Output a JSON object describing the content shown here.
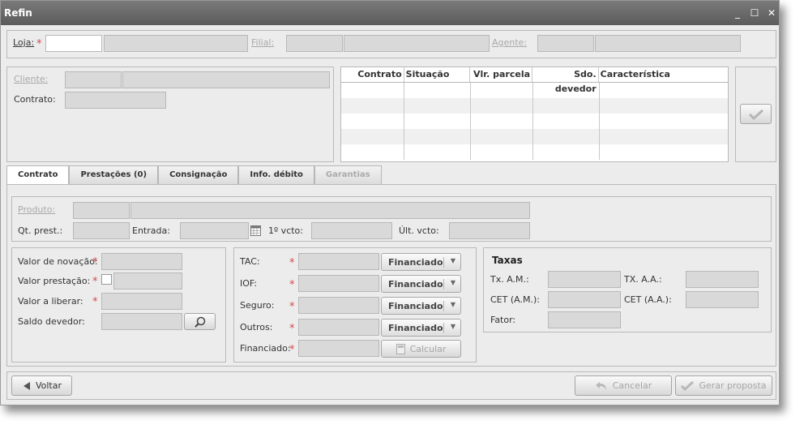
{
  "window": {
    "title": "Refin",
    "min": "_",
    "max": "☐",
    "close": "✕"
  },
  "header": {
    "loja": "Loja:",
    "filial": "Filial:",
    "agente": "Agente:"
  },
  "cliente": {
    "cliente_label": "Cliente:",
    "contrato_label": "Contrato:"
  },
  "table": {
    "columns": [
      "Contrato",
      "Situação",
      "Vlr. parcela",
      "Sdo. devedor",
      "Característica"
    ]
  },
  "tabs": [
    "Contrato",
    "Prestações (0)",
    "Consignação",
    "Info. débito",
    "Garantias"
  ],
  "produto": {
    "produto_label": "Produto:",
    "qt_prest": "Qt. prest.:",
    "entrada": "Entrada:",
    "primeiro_vcto": "1º vcto:",
    "ult_vcto": "Últ. vcto:"
  },
  "valores": {
    "novacao": "Valor de novação:",
    "prestacao": "Valor prestação:",
    "liberar": "Valor a liberar:",
    "saldo": "Saldo devedor:"
  },
  "custos": {
    "tac": "TAC:",
    "iof": "IOF:",
    "seguro": "Seguro:",
    "outros": "Outros:",
    "financiado": "Financiado:",
    "option": "Financiado",
    "calcular": "Calcular"
  },
  "taxas": {
    "title": "Taxas",
    "tx_am": "Tx. A.M.:",
    "tx_aa": "TX. A.A.:",
    "cet_am": "CET (A.M.):",
    "cet_aa": "CET (A.A.):",
    "fator": "Fator:"
  },
  "footer": {
    "voltar": "Voltar",
    "cancelar": "Cancelar",
    "gerar": "Gerar proposta"
  }
}
